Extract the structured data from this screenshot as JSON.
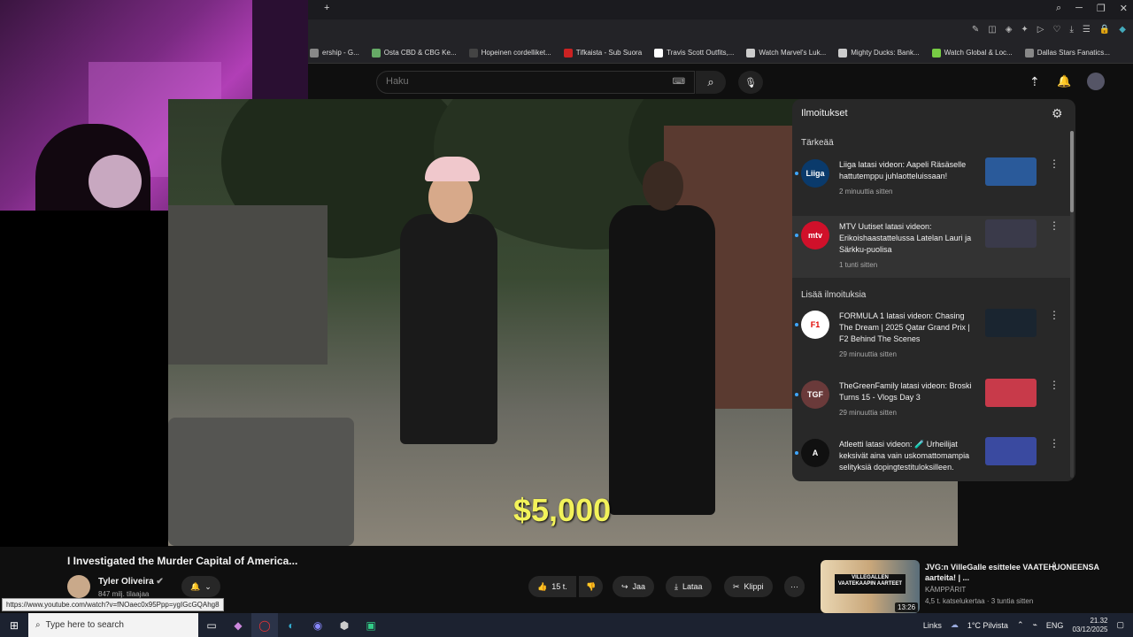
{
  "browser": {
    "bookmarks": [
      {
        "label": "ership - G...",
        "color": "#888"
      },
      {
        "label": "Osta CBD & CBG Ke...",
        "color": "#6a6"
      },
      {
        "label": "Hopeinen cordelliket...",
        "color": "#444"
      },
      {
        "label": "Tifkaista - Sub Suora",
        "color": "#c22"
      },
      {
        "label": "Travis Scott Outfits,...",
        "color": "#fff"
      },
      {
        "label": "Watch Marvel's Luk...",
        "color": "#ccc"
      },
      {
        "label": "Mighty Ducks: Bank...",
        "color": "#ccc"
      },
      {
        "label": "Watch Global & Loc...",
        "color": "#7c4"
      },
      {
        "label": "Dallas Stars Fanatics...",
        "color": "#888"
      }
    ],
    "url_tooltip": "https://www.youtube.com/watch?v=fNOaec0x95Ppp=ygIGcGQAhg8"
  },
  "youtube": {
    "search_placeholder": "Haku",
    "video_overlay_text": "$5,000",
    "video_title": "I Investigated the Murder Capital of America...",
    "channel_name": "Tyler Oliveira",
    "subscribers": "847 milj. tilaajaa",
    "actions": {
      "likes": "15 t.",
      "share": "Jaa",
      "download": "Lataa",
      "clip": "Klippi",
      "more": "···"
    },
    "recommended": {
      "title": "JVG:n VilleGalle esittelee VAATEHUONEENSA aarteita! | ...",
      "channel": "KÄMPPÄRIT",
      "meta": "4,5 t. katselukertaa · 3 tuntia sitten",
      "duration": "13:26",
      "thumb_text": "VILLEGALLEN VAATEKAAPIN AARTEET"
    }
  },
  "notifications": {
    "title": "Ilmoitukset",
    "section_important": "Tärkeää",
    "section_more": "Lisää ilmoituksia",
    "items": [
      {
        "avatar": "Liiga",
        "avatar_color": "#0a3a6b",
        "text": "Liiga latasi videon: Aapeli Räsäselle hattutemppu juhlaotteluissaan!",
        "time": "2 minuuttia sitten",
        "thumb_color": "#2a5a9a"
      },
      {
        "avatar": "mtv",
        "avatar_color": "#d0102a",
        "text": "MTV Uutiset latasi videon: Erikoishaastattelussa Latelan Lauri ja Särkku-puolisa",
        "time": "1 tunti sitten",
        "thumb_color": "#3a3a4a"
      },
      {
        "avatar": "F1",
        "avatar_color": "#ffffff",
        "text": "FORMULA 1 latasi videon: Chasing The Dream | 2025 Qatar Grand Prix | F2 Behind The Scenes",
        "time": "29 minuuttia sitten",
        "thumb_color": "#1a2530"
      },
      {
        "avatar": "TGF",
        "avatar_color": "#6a3a3a",
        "text": "TheGreenFamily latasi videon: Broski Turns 15 - Vlogs Day 3",
        "time": "29 minuuttia sitten",
        "thumb_color": "#c83a4a"
      },
      {
        "avatar": "A",
        "avatar_color": "#101010",
        "text": "Atleetti latasi videon: 🧪 Urheilijat keksivät aina vain uskomattomampia selityksiä dopingtestituloksilleen.",
        "time": "",
        "thumb_color": "#3a4aa0"
      }
    ]
  },
  "taskbar": {
    "search_placeholder": "Type here to search",
    "links": "Links",
    "weather": "1°C Pilvista",
    "language": "ENG",
    "time": "21.32",
    "date": "03/12/2025"
  }
}
